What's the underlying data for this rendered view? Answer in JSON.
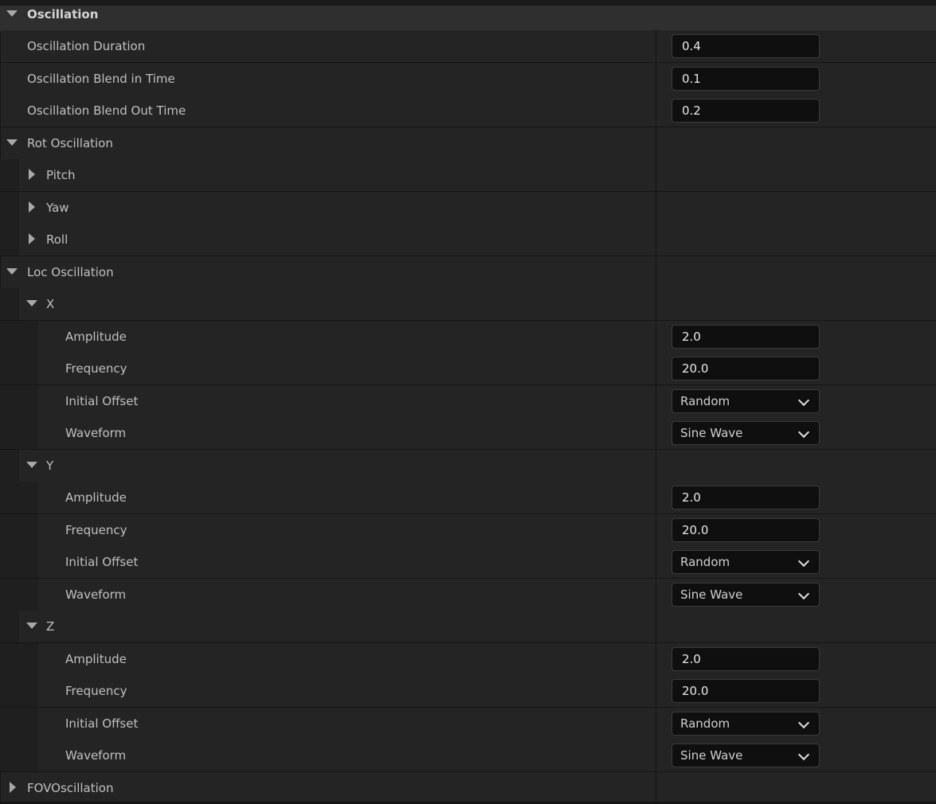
{
  "oscillation": {
    "header": "Oscillation",
    "duration": {
      "label": "Oscillation Duration",
      "value": "0.4"
    },
    "blend_in": {
      "label": "Oscillation Blend in Time",
      "value": "0.1"
    },
    "blend_out": {
      "label": "Oscillation Blend Out Time",
      "value": "0.2"
    }
  },
  "rot": {
    "label": "Rot Oscillation",
    "pitch": "Pitch",
    "yaw": "Yaw",
    "roll": "Roll"
  },
  "loc": {
    "label": "Loc Oscillation",
    "x": {
      "label": "X",
      "amplitude": {
        "label": "Amplitude",
        "value": "2.0"
      },
      "frequency": {
        "label": "Frequency",
        "value": "20.0"
      },
      "initial_offset": {
        "label": "Initial Offset",
        "value": "Random"
      },
      "waveform": {
        "label": "Waveform",
        "value": "Sine Wave"
      }
    },
    "y": {
      "label": "Y",
      "amplitude": {
        "label": "Amplitude",
        "value": "2.0"
      },
      "frequency": {
        "label": "Frequency",
        "value": "20.0"
      },
      "initial_offset": {
        "label": "Initial Offset",
        "value": "Random"
      },
      "waveform": {
        "label": "Waveform",
        "value": "Sine Wave"
      }
    },
    "z": {
      "label": "Z",
      "amplitude": {
        "label": "Amplitude",
        "value": "2.0"
      },
      "frequency": {
        "label": "Frequency",
        "value": "20.0"
      },
      "initial_offset": {
        "label": "Initial Offset",
        "value": "Random"
      },
      "waveform": {
        "label": "Waveform",
        "value": "Sine Wave"
      }
    }
  },
  "fov": {
    "label": "FOVOscillation"
  },
  "icons": {
    "expanded": "triangle-down-icon",
    "collapsed": "triangle-right-icon",
    "dropdown": "chevron-down-icon"
  },
  "colors": {
    "background": "#151515",
    "row": "#242424",
    "category_row": "#2f2f2f",
    "input_bg": "#0f0f0f",
    "text": "#c0c0c0"
  }
}
